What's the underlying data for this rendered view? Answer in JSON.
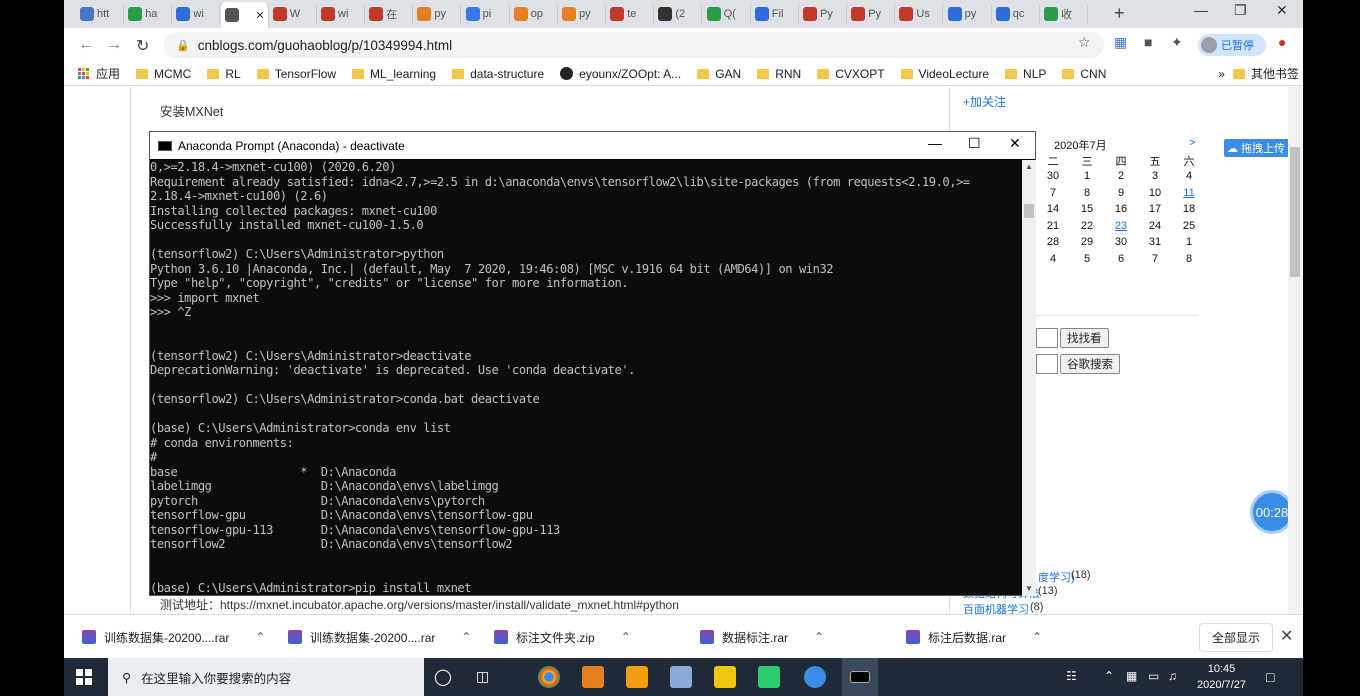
{
  "browser": {
    "tabs": [
      {
        "label": "htt",
        "color": "#4a76c9"
      },
      {
        "label": "ha",
        "color": "#2a9d4b"
      },
      {
        "label": "wi",
        "color": "#2f6bdc"
      },
      {
        "label": "",
        "color": "#555555",
        "active": true
      },
      {
        "label": "W",
        "color": "#c0392b"
      },
      {
        "label": "wi",
        "color": "#c0392b"
      },
      {
        "label": "在",
        "color": "#c0392b"
      },
      {
        "label": "py",
        "color": "#e67e22"
      },
      {
        "label": "pi",
        "color": "#3b78e7"
      },
      {
        "label": "op",
        "color": "#e67e22"
      },
      {
        "label": "py",
        "color": "#e67e22"
      },
      {
        "label": "te",
        "color": "#c0392b"
      },
      {
        "label": "(2",
        "color": "#333333"
      },
      {
        "label": "Q(",
        "color": "#2a9d4b"
      },
      {
        "label": "Fil",
        "color": "#2f6bdc"
      },
      {
        "label": "Py",
        "color": "#c0392b"
      },
      {
        "label": "Py",
        "color": "#c0392b"
      },
      {
        "label": "Us",
        "color": "#c0392b"
      },
      {
        "label": "py",
        "color": "#2f6bdc"
      },
      {
        "label": "qc",
        "color": "#2f6bdc"
      },
      {
        "label": "收",
        "color": "#2a9d4b"
      }
    ],
    "url": "cnblogs.com/guohaoblog/p/10349994.html",
    "profile_label": "已暂停",
    "bookmarks": [
      "应用",
      "MCMC",
      "RL",
      "TensorFlow",
      "ML_learning",
      "data-structure",
      "eyounx/ZOOpt: A...",
      "GAN",
      "RNN",
      "CVXOPT",
      "VideoLecture",
      "NLP",
      "CNN"
    ],
    "bookmarks_more": "»",
    "bookmarks_other": "其他书签"
  },
  "page": {
    "heading": "安装MXNet",
    "test_address": "测试地址：https://mxnet.incubator.apache.org/versions/master/install/validate_mxnet.html#python",
    "add_follow": "+加关注",
    "upload_badge": "拖拽上传",
    "timer": "00:28",
    "calendar": {
      "title": "2020年7月",
      "next": ">",
      "weekdays": [
        "二",
        "三",
        "四",
        "五",
        "六"
      ],
      "rows": [
        [
          "30",
          "1",
          "2",
          "3",
          "4"
        ],
        [
          "7",
          "8",
          "9",
          "10",
          "11"
        ],
        [
          "14",
          "15",
          "16",
          "17",
          "18"
        ],
        [
          "21",
          "22",
          "23",
          "24",
          "25"
        ],
        [
          "28",
          "29",
          "30",
          "31",
          "1"
        ],
        [
          "4",
          "5",
          "6",
          "7",
          "8"
        ]
      ],
      "links": [
        "11",
        "23"
      ]
    },
    "search_button_1": "找找看",
    "search_button_2": "谷歌搜索",
    "side_links": [
      {
        "label": "度学习)",
        "count": "(18)"
      },
      {
        "label": "数据结构与算法",
        "count": "(13)"
      },
      {
        "label": "百面机器学习",
        "count": "(8)"
      }
    ]
  },
  "console": {
    "title": "Anaconda Prompt (Anaconda) - deactivate",
    "lines": [
      "0,>=2.18.4->mxnet-cu100) (2020.6.20)",
      "Requirement already satisfied: idna<2.7,>=2.5 in d:\\anaconda\\envs\\tensorflow2\\lib\\site-packages (from requests<2.19.0,>=",
      "2.18.4->mxnet-cu100) (2.6)",
      "Installing collected packages: mxnet-cu100",
      "Successfully installed mxnet-cu100-1.5.0",
      "",
      "(tensorflow2) C:\\Users\\Administrator>python",
      "Python 3.6.10 |Anaconda, Inc.| (default, May  7 2020, 19:46:08) [MSC v.1916 64 bit (AMD64)] on win32",
      "Type \"help\", \"copyright\", \"credits\" or \"license\" for more information.",
      ">>> import mxnet",
      ">>> ^Z",
      "",
      "",
      "(tensorflow2) C:\\Users\\Administrator>deactivate",
      "DeprecationWarning: 'deactivate' is deprecated. Use 'conda deactivate'.",
      "",
      "(tensorflow2) C:\\Users\\Administrator>conda.bat deactivate",
      "",
      "(base) C:\\Users\\Administrator>conda env list",
      "# conda environments:",
      "#",
      "base                  *  D:\\Anaconda",
      "labelimgg                D:\\Anaconda\\envs\\labelimgg",
      "pytorch                  D:\\Anaconda\\envs\\pytorch",
      "tensorflow-gpu           D:\\Anaconda\\envs\\tensorflow-gpu",
      "tensorflow-gpu-113       D:\\Anaconda\\envs\\tensorflow-gpu-113",
      "tensorflow2              D:\\Anaconda\\envs\\tensorflow2",
      "",
      "",
      "(base) C:\\Users\\Administrator>pip install mxnet"
    ]
  },
  "downloads": {
    "items": [
      "训练数据集-20200....rar",
      "训练数据集-20200....rar",
      "标注文件夹.zip",
      "数据标注.rar",
      "标注后数据.rar"
    ],
    "show_all": "全部显示"
  },
  "taskbar": {
    "search_placeholder": "在这里输入你要搜索的内容",
    "time": "10:45",
    "date": "2020/7/27"
  }
}
